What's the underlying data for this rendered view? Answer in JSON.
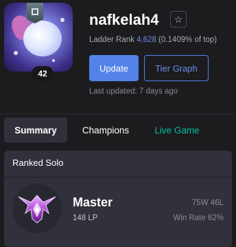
{
  "profile": {
    "name": "nafkelah4",
    "level": "42",
    "ladder_label": "Ladder Rank",
    "ladder_rank": "4,628",
    "ladder_pct": "(0.1409% of top)",
    "update_label": "Update",
    "tier_graph_label": "Tier Graph",
    "last_updated": "Last updated: 7 days ago",
    "favorite_icon": "star-outline-icon"
  },
  "tabs": [
    {
      "label": "Summary",
      "active": true
    },
    {
      "label": "Champions",
      "active": false
    },
    {
      "label": "Live Game",
      "active": false
    }
  ],
  "ranked": {
    "title": "Ranked Solo",
    "tier": "Master",
    "lp": "148 LP",
    "record": "75W 46L",
    "win_rate": "Win Rate 62%",
    "emblem_icon": "master-emblem-icon"
  },
  "colors": {
    "accent_blue": "#5383e8",
    "live_green": "#00bba3",
    "emblem_purple": "#b04ad8"
  }
}
